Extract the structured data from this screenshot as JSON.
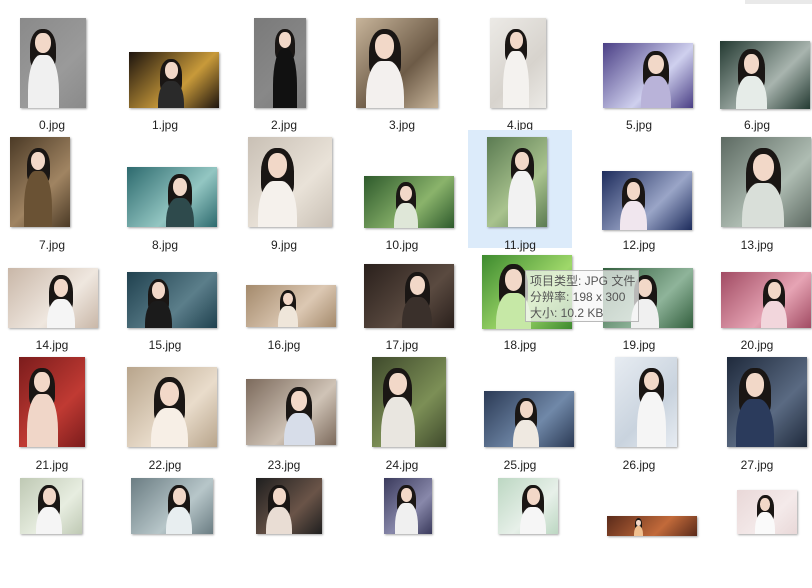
{
  "items": [
    {
      "name": "0.jpg"
    },
    {
      "name": "1.jpg"
    },
    {
      "name": "2.jpg"
    },
    {
      "name": "3.jpg"
    },
    {
      "name": "4.jpg"
    },
    {
      "name": "5.jpg"
    },
    {
      "name": "6.jpg"
    },
    {
      "name": "7.jpg"
    },
    {
      "name": "8.jpg"
    },
    {
      "name": "9.jpg"
    },
    {
      "name": "10.jpg"
    },
    {
      "name": "11.jpg"
    },
    {
      "name": "12.jpg"
    },
    {
      "name": "13.jpg"
    },
    {
      "name": "14.jpg"
    },
    {
      "name": "15.jpg"
    },
    {
      "name": "16.jpg"
    },
    {
      "name": "17.jpg"
    },
    {
      "name": "18.jpg"
    },
    {
      "name": "19.jpg"
    },
    {
      "name": "20.jpg"
    },
    {
      "name": "21.jpg"
    },
    {
      "name": "22.jpg"
    },
    {
      "name": "23.jpg"
    },
    {
      "name": "24.jpg"
    },
    {
      "name": "25.jpg"
    },
    {
      "name": "26.jpg"
    },
    {
      "name": "27.jpg"
    },
    {
      "name": ""
    },
    {
      "name": ""
    },
    {
      "name": ""
    },
    {
      "name": ""
    },
    {
      "name": ""
    },
    {
      "name": ""
    },
    {
      "name": ""
    }
  ],
  "selected_item": "11.jpg",
  "tooltip": {
    "type_line": "项目类型: JPG 文件",
    "dims_line": "分辨率: 198 x 300",
    "size_line": "大小: 10.2 KB"
  },
  "colors": {
    "selection": "#dcebfa",
    "label_text": "#1e1e1e",
    "background": "#ffffff"
  }
}
